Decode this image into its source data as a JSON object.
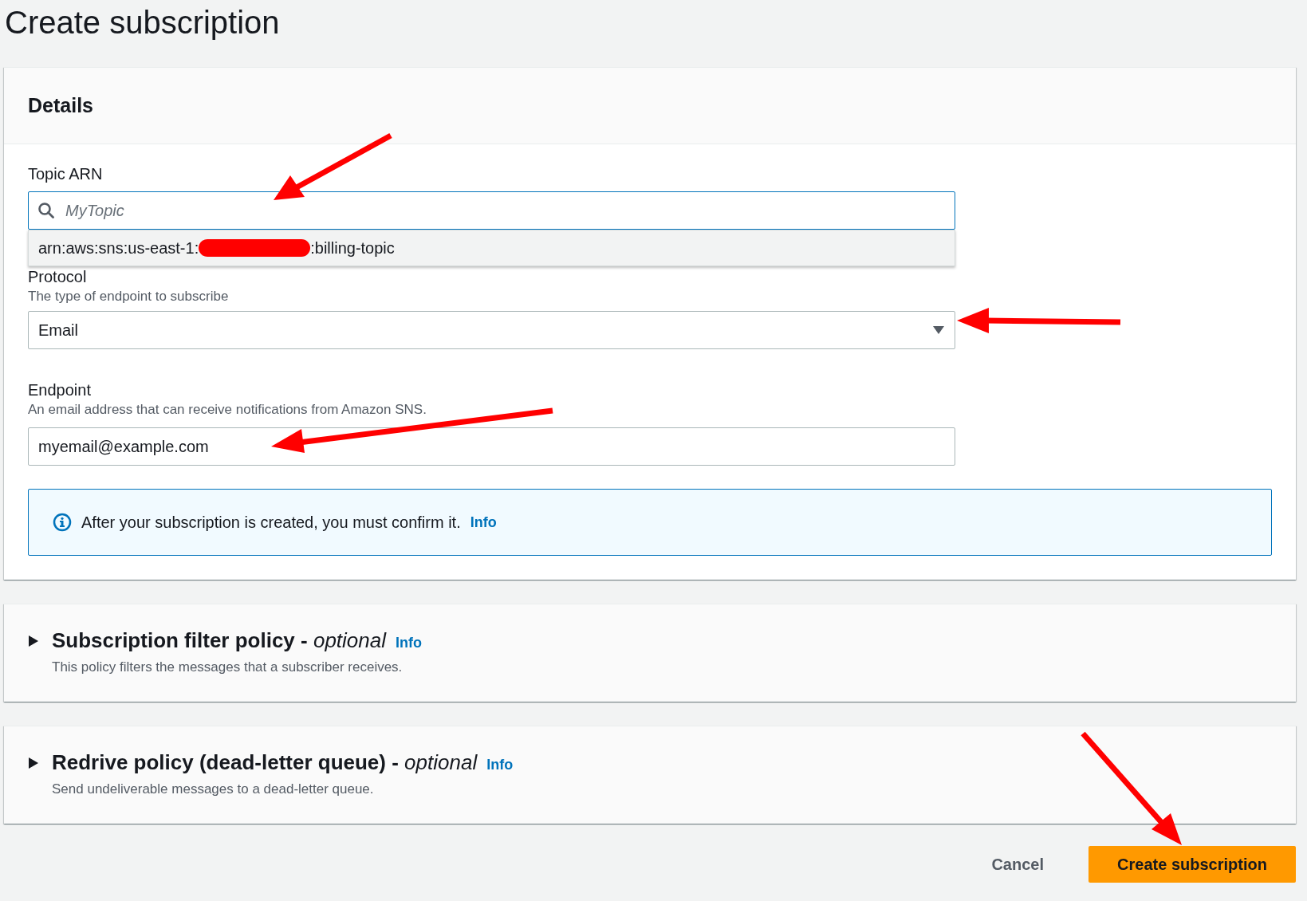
{
  "page_title": "Create subscription",
  "details": {
    "title": "Details",
    "topic_arn": {
      "label": "Topic ARN",
      "placeholder": "MyTopic",
      "suggestion": {
        "prefix": "arn:aws:sns:us-east-1:",
        "suffix": ":billing-topic",
        "redacted": true
      }
    },
    "protocol": {
      "label": "Protocol",
      "description": "The type of endpoint to subscribe",
      "value": "Email"
    },
    "endpoint": {
      "label": "Endpoint",
      "description": "An email address that can receive notifications from Amazon SNS.",
      "value": "myemail@example.com"
    },
    "notice": {
      "text": "After your subscription is created, you must confirm it.",
      "link": "Info"
    }
  },
  "sections": [
    {
      "title": "Subscription filter policy - ",
      "optional": "optional",
      "link": "Info",
      "description": "This policy filters the messages that a subscriber receives.",
      "expanded": false
    },
    {
      "title": "Redrive policy (dead-letter queue) - ",
      "optional": "optional",
      "link": "Info",
      "description": "Send undeliverable messages to a dead-letter queue.",
      "expanded": false
    }
  ],
  "buttons": [
    {
      "label": "Cancel",
      "kind": "link"
    },
    {
      "label": "Create subscription",
      "kind": "primary"
    }
  ]
}
